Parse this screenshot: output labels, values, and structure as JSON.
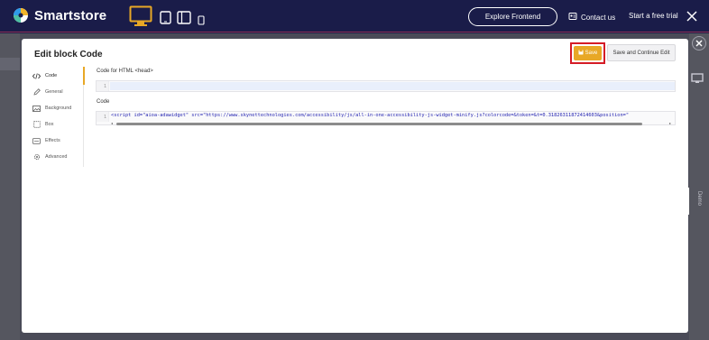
{
  "brand": {
    "name": "Smartstore"
  },
  "topbar": {
    "explore_label": "Explore Frontend",
    "contact_label": "Contact us",
    "trial_label": "Start a free trial",
    "devices": [
      "desktop-icon",
      "tablet-icon",
      "tablet-landscape-icon",
      "mobile-icon"
    ],
    "active_device": "desktop",
    "accent": "#e8a826"
  },
  "modal": {
    "title": "Edit block Code",
    "save_label": "Save",
    "save_continue_label": "Save and Continue Edit",
    "nav": [
      {
        "label": "Code",
        "icon": "code-icon",
        "active": true
      },
      {
        "label": "General",
        "icon": "pencil-icon",
        "active": false
      },
      {
        "label": "Background",
        "icon": "image-icon",
        "active": false
      },
      {
        "label": "Box",
        "icon": "box-icon",
        "active": false
      },
      {
        "label": "Effects",
        "icon": "effects-icon",
        "active": false
      },
      {
        "label": "Advanced",
        "icon": "gear-icon",
        "active": false
      }
    ],
    "head_label": "Code for HTML <head>",
    "head_line_number": "1",
    "head_value": "",
    "code_label": "Code",
    "code_line_number": "1",
    "code_value": "<script id=\"aioa-adawidget\" src=\"https://www.skynettechnologies.com/accessibility/js/all-in-one-accessibility-js-widget-minify.js?colorcode=&token=&t=0.31826311872414603&position=\""
  },
  "side_tab": {
    "label": "Demo"
  },
  "highlight_color": "#d51c26"
}
